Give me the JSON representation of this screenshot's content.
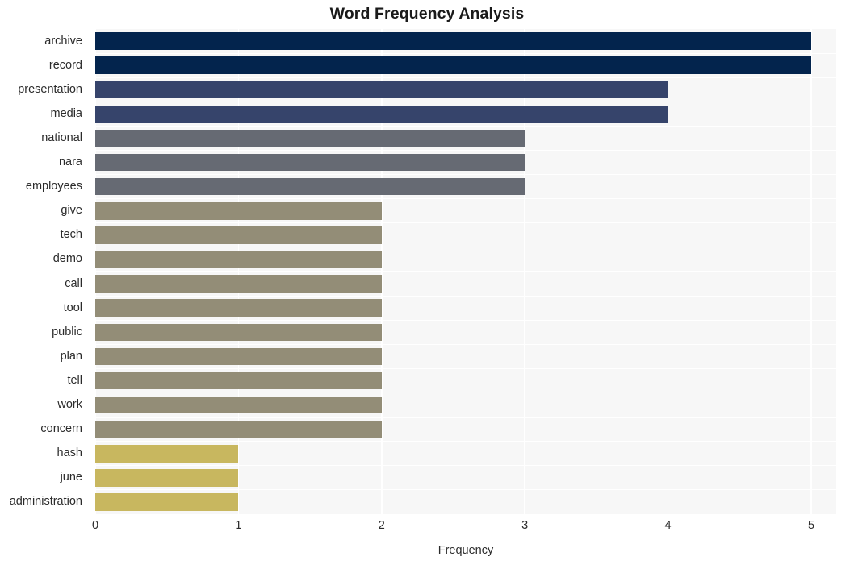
{
  "chart_data": {
    "type": "bar",
    "orientation": "horizontal",
    "title": "Word Frequency Analysis",
    "xlabel": "Frequency",
    "ylabel": "",
    "xlim": [
      0,
      5
    ],
    "xticks": [
      "0",
      "1",
      "2",
      "3",
      "4",
      "5"
    ],
    "grid": true,
    "legend": "none",
    "categories": [
      "archive",
      "record",
      "presentation",
      "media",
      "national",
      "nara",
      "employees",
      "give",
      "tech",
      "demo",
      "call",
      "tool",
      "public",
      "plan",
      "tell",
      "work",
      "concern",
      "hash",
      "june",
      "administration"
    ],
    "values": [
      5,
      5,
      4,
      4,
      3,
      3,
      3,
      2,
      2,
      2,
      2,
      2,
      2,
      2,
      2,
      2,
      2,
      1,
      1,
      1
    ],
    "bar_colors": [
      "#03244d",
      "#03244d",
      "#36446b",
      "#36446b",
      "#666a73",
      "#666a73",
      "#666a73",
      "#938d77",
      "#938d77",
      "#938d77",
      "#938d77",
      "#938d77",
      "#938d77",
      "#938d77",
      "#938d77",
      "#938d77",
      "#938d77",
      "#c8b75f",
      "#c8b75f",
      "#c8b75f"
    ],
    "palette": {
      "freq_5": "#03244d",
      "freq_4": "#36446b",
      "freq_3": "#666a73",
      "freq_2": "#938d77",
      "freq_1": "#c8b75f"
    },
    "plot_background": "#f7f7f7",
    "gridline_color": "#ffffff"
  }
}
